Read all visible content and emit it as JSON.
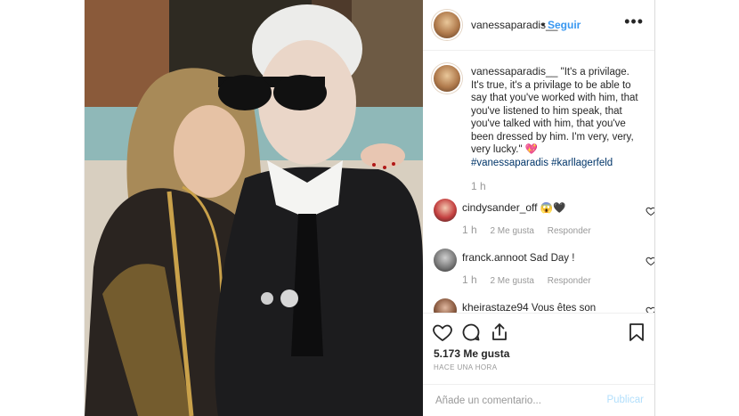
{
  "header": {
    "username": "vanessaparadis__",
    "separator": "•",
    "follow_label": "Seguir",
    "more_label": "•••"
  },
  "caption": {
    "username": "vanessaparadis__",
    "text": "\"It's a privilage. It's true, it's a privilage to be able to say that you've worked with him, that you've listened to him speak, that you've talked with him, that you've been dressed by him. I'm very, very, very lucky.\" 💖",
    "hashtag_1": "#vanessaparadis",
    "hashtag_2": "#karllagerfeld",
    "time": "1 h"
  },
  "comments": [
    {
      "username": "cindysander_off",
      "text": "😱🖤",
      "time": "1 h",
      "likes": "2 Me gusta",
      "reply": "Responder"
    },
    {
      "username": "franck.annoot",
      "text": "Sad Day !",
      "time": "1 h",
      "likes": "2 Me gusta",
      "reply": "Responder"
    },
    {
      "username": "kheirastaze94",
      "text": "Vous êtes son"
    }
  ],
  "actions": {
    "like_icon": "heart-icon",
    "comment_icon": "comment-icon",
    "share_icon": "share-icon",
    "save_icon": "bookmark-icon",
    "likes": "5.173 Me gusta",
    "posted": "HACE UNA HORA"
  },
  "add_comment": {
    "placeholder": "Añade un comentario...",
    "publish_label": "Publicar"
  },
  "colors": {
    "link": "#3897f0",
    "hashtag": "#003569",
    "muted": "#999999",
    "publish_disabled": "#b2dffc"
  }
}
